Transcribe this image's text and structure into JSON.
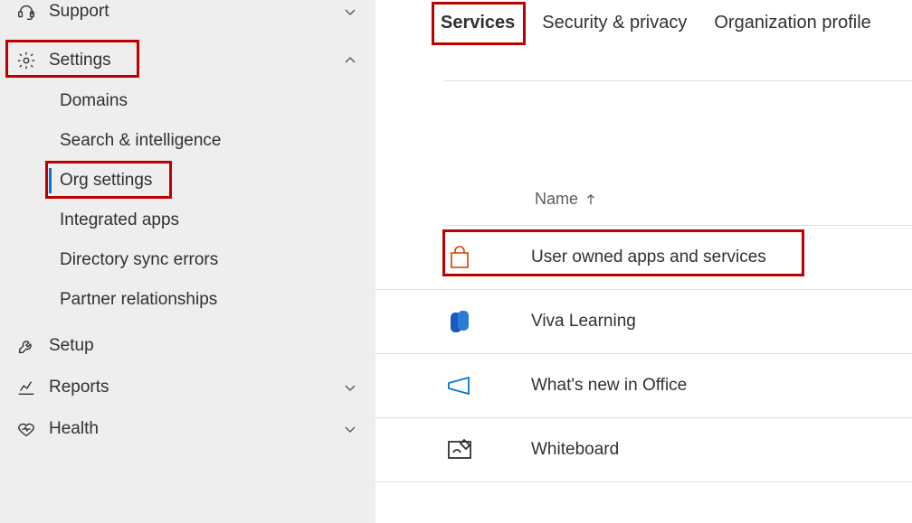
{
  "sidebar": {
    "items": [
      {
        "label": "Support"
      },
      {
        "label": "Settings"
      },
      {
        "label": "Setup"
      },
      {
        "label": "Reports"
      },
      {
        "label": "Health"
      }
    ],
    "settings_children": [
      {
        "label": "Domains"
      },
      {
        "label": "Search & intelligence"
      },
      {
        "label": "Org settings"
      },
      {
        "label": "Integrated apps"
      },
      {
        "label": "Directory sync errors"
      },
      {
        "label": "Partner relationships"
      }
    ]
  },
  "tabs": [
    {
      "label": "Services"
    },
    {
      "label": "Security & privacy"
    },
    {
      "label": "Organization profile"
    }
  ],
  "table": {
    "column_header": "Name",
    "rows": [
      {
        "label": "User owned apps and services"
      },
      {
        "label": "Viva Learning"
      },
      {
        "label": "What's new in Office"
      },
      {
        "label": "Whiteboard"
      }
    ]
  }
}
